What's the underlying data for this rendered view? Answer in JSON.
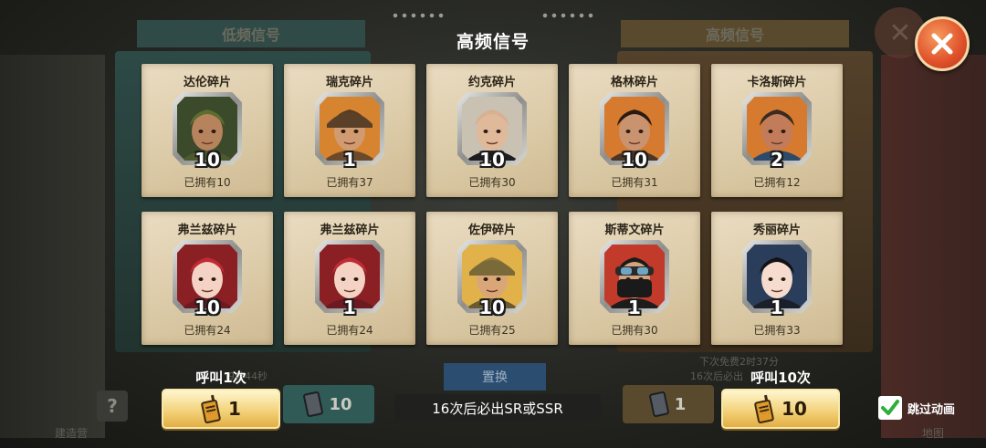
{
  "background": {
    "tab_low": "低频信号",
    "tab_high": "高频信号",
    "timer_left": "9分44秒",
    "timer_right_1": "下次免费2时37分",
    "timer_right_2": "16次后必出",
    "replace_label": "置换",
    "left_btn_count": "10",
    "right_btn_count": "1",
    "help_label": "?",
    "bottom_left_text": "建造营",
    "bottom_right_text": "地图"
  },
  "dialog": {
    "title": "高频信号",
    "pity_text": "16次后必出SR或SSR",
    "skip_label": "跳过动画",
    "skip_checked": true
  },
  "cards": [
    {
      "name": "达伦碎片",
      "count": "10",
      "owned": "已拥有10",
      "face": "darren"
    },
    {
      "name": "瑞克碎片",
      "count": "1",
      "owned": "已拥有37",
      "face": "rick"
    },
    {
      "name": "约克碎片",
      "count": "10",
      "owned": "已拥有30",
      "face": "york"
    },
    {
      "name": "格林碎片",
      "count": "10",
      "owned": "已拥有31",
      "face": "green"
    },
    {
      "name": "卡洛斯碎片",
      "count": "2",
      "owned": "已拥有12",
      "face": "carlos"
    },
    {
      "name": "弗兰兹碎片",
      "count": "10",
      "owned": "已拥有24",
      "face": "franz"
    },
    {
      "name": "弗兰兹碎片",
      "count": "1",
      "owned": "已拥有24",
      "face": "franz"
    },
    {
      "name": "佐伊碎片",
      "count": "10",
      "owned": "已拥有25",
      "face": "zoe"
    },
    {
      "name": "斯蒂文碎片",
      "count": "1",
      "owned": "已拥有30",
      "face": "steven"
    },
    {
      "name": "秀丽碎片",
      "count": "1",
      "owned": "已拥有33",
      "face": "xiuli"
    }
  ],
  "call_once": {
    "label": "呼叫1次",
    "cost": "1"
  },
  "call_ten": {
    "label": "呼叫10次",
    "cost": "10"
  },
  "colors": {
    "card_bg": "#dccba8",
    "button_gold": "#f3d37c",
    "close_orange": "#e0502a"
  }
}
